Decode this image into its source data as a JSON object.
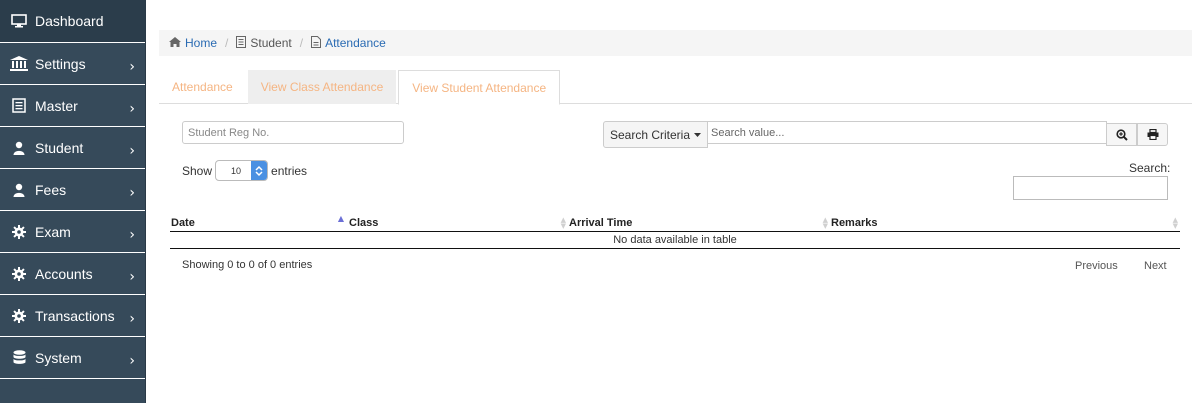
{
  "sidebar": {
    "items": [
      {
        "label": "Dashboard",
        "icon": "monitor-icon",
        "active": true,
        "chevron": false
      },
      {
        "label": "Settings",
        "icon": "bank-icon",
        "chevron": true
      },
      {
        "label": "Master",
        "icon": "list-icon",
        "chevron": true
      },
      {
        "label": "Student",
        "icon": "user-icon",
        "chevron": true
      },
      {
        "label": "Fees",
        "icon": "user-icon",
        "chevron": true
      },
      {
        "label": "Exam",
        "icon": "gear-icon",
        "chevron": true
      },
      {
        "label": "Accounts",
        "icon": "gear-icon",
        "chevron": true
      },
      {
        "label": "Transactions",
        "icon": "gear-icon",
        "chevron": true
      },
      {
        "label": "System",
        "icon": "database-icon",
        "chevron": true
      }
    ],
    "chevron_glyph": "›"
  },
  "breadcrumb": {
    "home": "Home",
    "student": "Student",
    "attendance": "Attendance",
    "separator": "/"
  },
  "tabs": [
    {
      "label": "Attendance"
    },
    {
      "label": "View Class Attendance"
    },
    {
      "label": "View Student Attendance"
    }
  ],
  "filters": {
    "reg_placeholder": "Student Reg No.",
    "criteria_label": "Search Criteria",
    "search_value_placeholder": "Search value..."
  },
  "table_controls": {
    "show": "Show",
    "length_value": "10",
    "entries": "entries",
    "search_label": "Search:"
  },
  "table": {
    "columns": [
      "Date",
      "Class",
      "Arrival Time",
      "Remarks"
    ],
    "empty_message": "No data available in table",
    "info": "Showing 0 to 0 of 0 entries",
    "previous": "Previous",
    "next": "Next"
  },
  "colors": {
    "sidebar_bg": "#364a5a",
    "link": "#2a6bb3",
    "tab_text": "#f5b583",
    "spinner": "#4a90e2"
  }
}
